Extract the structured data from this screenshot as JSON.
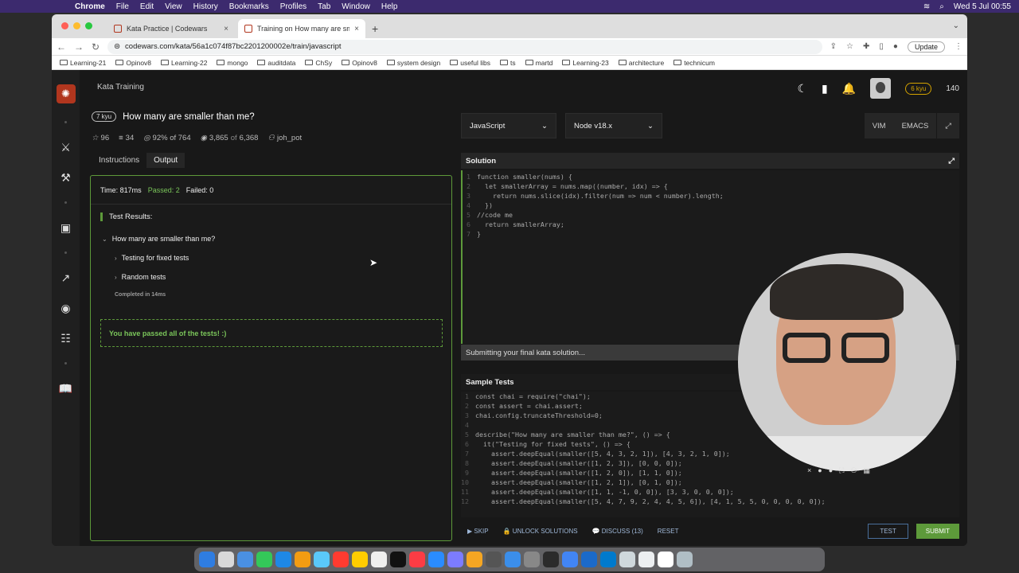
{
  "menubar": {
    "app": "Chrome",
    "items": [
      "File",
      "Edit",
      "View",
      "History",
      "Bookmarks",
      "Profiles",
      "Tab",
      "Window",
      "Help"
    ],
    "clock": "Wed 5 Jul  00:55"
  },
  "tabs": [
    {
      "title": "Kata Practice | Codewars"
    },
    {
      "title": "Training on How many are sma"
    }
  ],
  "address": {
    "url": "codewars.com/kata/56a1c074f87bc2201200002e/train/javascript",
    "update_label": "Update"
  },
  "bookmarks": [
    "Learning-21",
    "Opinov8",
    "Learning-22",
    "mongo",
    "auditdata",
    "ChSy",
    "Opinov8",
    "system design",
    "useful libs",
    "ts",
    "martd",
    "Learning-23",
    "architecture",
    "technicum"
  ],
  "header": {
    "section": "Kata Training",
    "rank": "6 kyu",
    "honor": "140"
  },
  "kata": {
    "kyu": "7 kyu",
    "title": "How many are smaller than me?",
    "stars": "96",
    "collections": "34",
    "satisfaction": "92% of 764",
    "completed_a": "3,865",
    "completed_of": "of",
    "completed_b": "6,368",
    "author": "joh_pot"
  },
  "left_tabs": {
    "instructions": "Instructions",
    "output": "Output"
  },
  "output": {
    "time": "Time: 817ms",
    "passed": "Passed: 2",
    "failed": "Failed: 0",
    "results_title": "Test Results:",
    "suite": "How many are smaller than me?",
    "group1": "Testing for fixed tests",
    "group2": "Random tests",
    "completed": "Completed in 14ms",
    "success": "You have passed all of the tests! :)"
  },
  "editor": {
    "language": "JavaScript",
    "runtime": "Node v18.x",
    "vim": "VIM",
    "emacs": "EMACS",
    "solution_title": "Solution",
    "solution_lines": [
      "function smaller(nums) {",
      "  let smallerArray = nums.map((number, idx) => {",
      "    return nums.slice(idx).filter(num => num < number).length;",
      "  })",
      "//code me",
      "  return smallerArray;",
      "}"
    ],
    "submitting": "Submitting your final kata solution...",
    "tests_title": "Sample Tests",
    "test_lines": [
      "const chai = require(\"chai\");",
      "const assert = chai.assert;",
      "chai.config.truncateThreshold=0;",
      "",
      "describe(\"How many are smaller than me?\", () => {",
      "  it(\"Testing for fixed tests\", () => {",
      "    assert.deepEqual(smaller([5, 4, 3, 2, 1]), [4, 3, 2, 1, 0]);",
      "    assert.deepEqual(smaller([1, 2, 3]), [0, 0, 0]);",
      "    assert.deepEqual(smaller([1, 2, 0]), [1, 1, 0]);",
      "    assert.deepEqual(smaller([1, 2, 1]), [0, 1, 0]);",
      "    assert.deepEqual(smaller([1, 1, -1, 0, 0]), [3, 3, 0, 0, 0]);",
      "    assert.deepEqual(smaller([5, 4, 7, 9, 2, 4, 4, 5, 6]), [4, 1, 5, 5, 0, 0, 0, 0, 0]);"
    ]
  },
  "actions": {
    "skip": "SKIP",
    "unlock": "UNLOCK SOLUTIONS",
    "discuss": "DISCUSS (13)",
    "reset": "RESET",
    "test": "TEST",
    "submit": "SUBMIT"
  },
  "colors": {
    "brand": "#b1361e",
    "success": "#5d9a3a",
    "rank": "#d4a300"
  }
}
